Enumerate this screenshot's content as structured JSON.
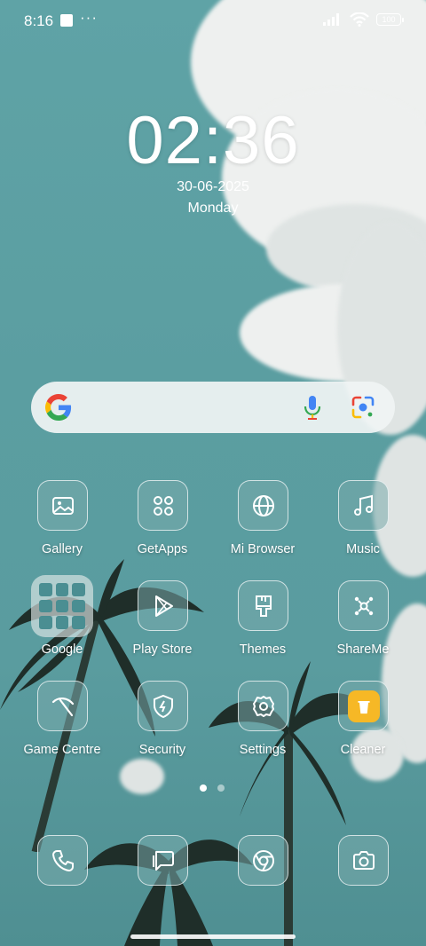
{
  "status_bar": {
    "time": "8:16",
    "more": "···",
    "battery": "100"
  },
  "clock_widget": {
    "time": "02:36",
    "date": "30-06-2025",
    "weekday": "Monday"
  },
  "search_widget": {
    "logo": "google-g-icon",
    "mic": "mic-icon",
    "lens": "lens-icon"
  },
  "apps": [
    {
      "label": "Gallery",
      "icon": "gallery-icon"
    },
    {
      "label": "GetApps",
      "icon": "getapps-icon"
    },
    {
      "label": "Mi Browser",
      "icon": "globe-icon"
    },
    {
      "label": "Music",
      "icon": "music-icon"
    },
    {
      "label": "Google",
      "icon": "folder-icon"
    },
    {
      "label": "Play Store",
      "icon": "play-store-icon"
    },
    {
      "label": "Themes",
      "icon": "brush-icon"
    },
    {
      "label": "ShareMe",
      "icon": "share-icon"
    },
    {
      "label": "Game Centre",
      "icon": "game-icon"
    },
    {
      "label": "Security",
      "icon": "shield-icon"
    },
    {
      "label": "Settings",
      "icon": "gear-icon"
    },
    {
      "label": "Cleaner",
      "icon": "trash-icon"
    }
  ],
  "dock": [
    {
      "icon": "phone-icon"
    },
    {
      "icon": "messages-icon"
    },
    {
      "icon": "chrome-icon"
    },
    {
      "icon": "camera-icon"
    }
  ],
  "pager": {
    "pages": 2,
    "active": 1
  },
  "colors": {
    "wallpaper_teal": "#5b9ea1",
    "cleaner_yellow": "#f6b826",
    "google_blue": "#4285F4",
    "google_red": "#EA4335",
    "google_yellow": "#FBBC05",
    "google_green": "#34A853"
  }
}
